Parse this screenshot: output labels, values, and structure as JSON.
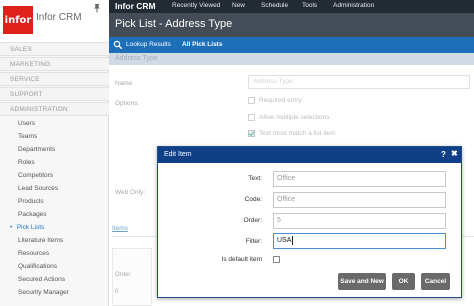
{
  "app": {
    "logo_mark": "infor",
    "logo_text": "Infor CRM"
  },
  "topbar": {
    "brand": "Infor CRM",
    "nav": [
      "Recently Viewed",
      "New",
      "Schedule",
      "Tools",
      "Administration"
    ]
  },
  "sidebar": {
    "sections": [
      "SALES",
      "MARKETING",
      "SERVICE",
      "SUPPORT",
      "ADMINISTRATION"
    ],
    "items": [
      "Users",
      "Teams",
      "Departments",
      "Roles",
      "Competitors",
      "Lead Sources",
      "Products",
      "Packages",
      "Pick Lists",
      "Literature Items",
      "Resources",
      "Qualifications",
      "Secured Actions",
      "Security Manager"
    ],
    "active_item": "Pick Lists"
  },
  "page": {
    "title": "Pick List - Address Type",
    "tabs": [
      "Lookup Results",
      "All Pick Lists"
    ],
    "panel_title": "Address Type",
    "name_label": "Name",
    "name_placeholder": "Address Type",
    "options_label": "Options:",
    "options": [
      {
        "label": "Required entry",
        "checked": false
      },
      {
        "label": "Allow multiple selections",
        "checked": false
      },
      {
        "label": "Text must match a list item",
        "checked": true
      }
    ],
    "web_only_label": "Web Only:",
    "items_tab": "Items",
    "grid_col": "Order",
    "grid_value": "0"
  },
  "modal": {
    "title": "Edit Item",
    "help_icon": "?",
    "close_icon": "✖",
    "fields": [
      {
        "label": "Text:",
        "value": "Office"
      },
      {
        "label": "Code:",
        "value": "Office"
      },
      {
        "label": "Order:",
        "value": "5"
      },
      {
        "label": "Filter:",
        "value": "USA"
      }
    ],
    "default_label": "Is default item",
    "buttons": {
      "save_new": "Save and New",
      "ok": "OK",
      "cancel": "Cancel"
    }
  },
  "colors": {
    "logo_red": "#e0211b",
    "topbar": "#222a33",
    "titlebar": "#444c57",
    "tabbar": "#1d6fb8",
    "modal_head": "#0e3f87"
  }
}
